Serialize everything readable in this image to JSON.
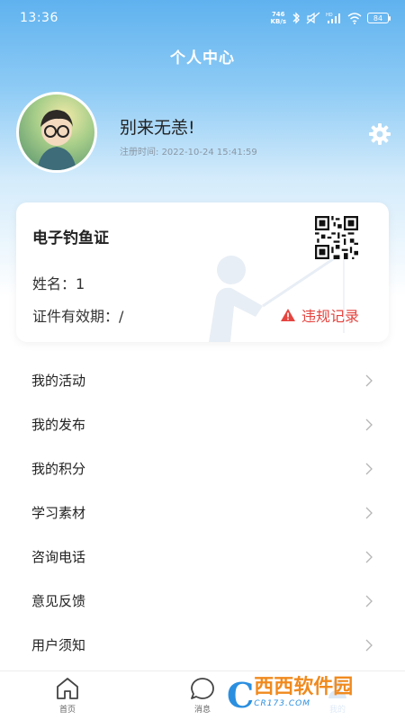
{
  "status_bar": {
    "time": "13:36",
    "net_speed_value": "746",
    "net_speed_unit": "KB/s",
    "hd_label": "HD",
    "battery": "84"
  },
  "header": {
    "title": "个人中心"
  },
  "profile": {
    "greeting": "别来无恙!",
    "reg_label": "注册时间:",
    "reg_time": "2022-10-24 15:41:59"
  },
  "license_card": {
    "title": "电子钓鱼证",
    "name_line": "姓名：1",
    "validity_line": "证件有效期：/",
    "violation_label": "违规记录"
  },
  "menu": {
    "items": [
      {
        "label": "我的活动"
      },
      {
        "label": "我的发布"
      },
      {
        "label": "我的积分"
      },
      {
        "label": "学习素材"
      },
      {
        "label": "咨询电话"
      },
      {
        "label": "意见反馈"
      },
      {
        "label": "用户须知"
      }
    ]
  },
  "tabbar": {
    "tabs": [
      {
        "label": "首页"
      },
      {
        "label": "消息"
      },
      {
        "label": "我的"
      }
    ]
  },
  "watermark": {
    "main": "西西软件园",
    "sub": "CR173.COM"
  },
  "colors": {
    "primary": "#5fb2ef",
    "danger": "#e5443f",
    "tab_active": "#1f6fc1"
  },
  "icons": {
    "settings": "gear-icon",
    "chevron": "chevron-right-icon",
    "warning": "warning-icon",
    "home": "home-icon",
    "message": "message-icon",
    "mine": "user-icon"
  }
}
